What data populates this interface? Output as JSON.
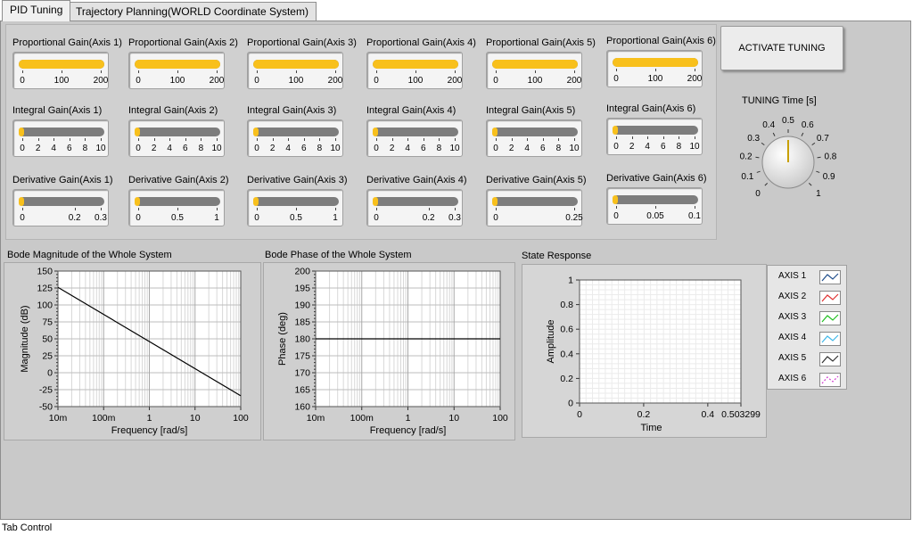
{
  "tabs": [
    {
      "label": "PID Tuning",
      "active": true
    },
    {
      "label": "Trajectory Planning(WORLD  Coordinate System)",
      "active": false
    }
  ],
  "footer_label": "Tab Control",
  "activate_button": "ACTIVATE TUNING",
  "tuning_time": {
    "label": "TUNING Time [s]",
    "scale": [
      "0",
      "0.1",
      "0.2",
      "0.3",
      "0.4",
      "0.5",
      "0.6",
      "0.7",
      "0.8",
      "0.9",
      "1"
    ],
    "value": 0.5
  },
  "gains": {
    "proportional": [
      {
        "label": "Proportional Gain(Axis 1)",
        "ticks": [
          "0",
          "100",
          "200"
        ],
        "fraction": 1.0
      },
      {
        "label": "Proportional Gain(Axis 2)",
        "ticks": [
          "0",
          "100",
          "200"
        ],
        "fraction": 1.0
      },
      {
        "label": "Proportional Gain(Axis 3)",
        "ticks": [
          "0",
          "100",
          "200"
        ],
        "fraction": 1.0
      },
      {
        "label": "Proportional Gain(Axis 4)",
        "ticks": [
          "0",
          "100",
          "200"
        ],
        "fraction": 1.0
      },
      {
        "label": "Proportional Gain(Axis 5)",
        "ticks": [
          "0",
          "100",
          "200"
        ],
        "fraction": 1.0
      },
      {
        "label": "Proportional Gain(Axis 6)",
        "ticks": [
          "0",
          "100",
          "200"
        ],
        "fraction": 1.0
      }
    ],
    "integral": [
      {
        "label": "Integral Gain(Axis 1)",
        "ticks": [
          "0",
          "2",
          "4",
          "6",
          "8",
          "10"
        ],
        "fraction": 0.0
      },
      {
        "label": "Integral Gain(Axis 2)",
        "ticks": [
          "0",
          "2",
          "4",
          "6",
          "8",
          "10"
        ],
        "fraction": 0.0
      },
      {
        "label": "Integral Gain(Axis 3)",
        "ticks": [
          "0",
          "2",
          "4",
          "6",
          "8",
          "10"
        ],
        "fraction": 0.0
      },
      {
        "label": "Integral Gain(Axis 4)",
        "ticks": [
          "0",
          "2",
          "4",
          "6",
          "8",
          "10"
        ],
        "fraction": 0.0
      },
      {
        "label": "Integral Gain(Axis 5)",
        "ticks": [
          "0",
          "2",
          "4",
          "6",
          "8",
          "10"
        ],
        "fraction": 0.0
      },
      {
        "label": "Integral Gain(Axis 6)",
        "ticks": [
          "0",
          "2",
          "4",
          "6",
          "8",
          "10"
        ],
        "fraction": 0.0
      }
    ],
    "derivative": [
      {
        "label": "Derivative Gain(Axis 1)",
        "ticks": [
          "0",
          "0.2",
          "0.3"
        ],
        "tickvals": [
          0,
          0.2,
          0.3
        ],
        "max": 0.3,
        "fraction": 0.0
      },
      {
        "label": "Derivative Gain(Axis 2)",
        "ticks": [
          "0",
          "0.5",
          "1"
        ],
        "tickvals": [
          0,
          0.5,
          1
        ],
        "max": 1,
        "fraction": 0.0
      },
      {
        "label": "Derivative Gain(Axis 3)",
        "ticks": [
          "0",
          "0.5",
          "1"
        ],
        "tickvals": [
          0,
          0.5,
          1
        ],
        "max": 1,
        "fraction": 0.0
      },
      {
        "label": "Derivative Gain(Axis 4)",
        "ticks": [
          "0",
          "0.2",
          "0.3"
        ],
        "tickvals": [
          0,
          0.2,
          0.3
        ],
        "max": 0.3,
        "fraction": 0.0
      },
      {
        "label": "Derivative Gain(Axis 5)",
        "ticks": [
          "0",
          "0.25"
        ],
        "tickvals": [
          0,
          0.25
        ],
        "max": 0.25,
        "fraction": 0.0
      },
      {
        "label": "Derivative Gain(Axis 6)",
        "ticks": [
          "0",
          "0.05",
          "0.1"
        ],
        "tickvals": [
          0,
          0.05,
          0.1
        ],
        "max": 0.1,
        "fraction": 0.0
      }
    ]
  },
  "plots": {
    "bode_mag": {
      "title": "Bode Magnitude of the Whole System",
      "xlabel": "Frequency [rad/s]",
      "ylabel": "Magnitude (dB)",
      "xticks": [
        "10m",
        "100m",
        "1",
        "10",
        "100"
      ],
      "yticks": [
        "150",
        "125",
        "100",
        "75",
        "50",
        "25",
        "0",
        "-25",
        "-50"
      ],
      "xlim": [
        0.01,
        100
      ],
      "ylim": [
        -50,
        150
      ],
      "line": {
        "x": [
          0.01,
          100
        ],
        "y": [
          126,
          -34
        ]
      }
    },
    "bode_phase": {
      "title": "Bode Phase of the Whole System",
      "xlabel": "Frequency [rad/s]",
      "ylabel": "Phase (deg)",
      "xticks": [
        "10m",
        "100m",
        "1",
        "10",
        "100"
      ],
      "yticks": [
        "200",
        "195",
        "190",
        "185",
        "180",
        "175",
        "170",
        "165",
        "160"
      ],
      "xlim": [
        0.01,
        100
      ],
      "ylim": [
        160,
        200
      ],
      "line": {
        "x": [
          0.01,
          100
        ],
        "y": [
          180,
          180
        ]
      }
    },
    "state": {
      "title": "State Response",
      "xlabel": "Time",
      "ylabel": "Amplitude",
      "xticks": [
        "0",
        "0.2",
        "0.4",
        "0.503299"
      ],
      "yticks": [
        "1",
        "0.8",
        "0.6",
        "0.4",
        "0.2",
        "0"
      ],
      "xlim": [
        0,
        0.503299
      ],
      "ylim": [
        0,
        1
      ]
    }
  },
  "legend": [
    {
      "name": "AXIS 1",
      "color": "#1f4e8c"
    },
    {
      "name": "AXIS 2",
      "color": "#e03030"
    },
    {
      "name": "AXIS 3",
      "color": "#20c020"
    },
    {
      "name": "AXIS 4",
      "color": "#40b8e8"
    },
    {
      "name": "AXIS 5",
      "color": "#303030"
    },
    {
      "name": "AXIS 6",
      "color": "#d040d0"
    }
  ],
  "chart_data": [
    {
      "type": "line",
      "title": "Bode Magnitude of the Whole System",
      "xlabel": "Frequency [rad/s]",
      "ylabel": "Magnitude (dB)",
      "xscale": "log",
      "xlim": [
        0.01,
        100
      ],
      "ylim": [
        -50,
        150
      ],
      "grid": true,
      "series": [
        {
          "x": [
            0.01,
            100
          ],
          "y": [
            126,
            -34
          ]
        }
      ]
    },
    {
      "type": "line",
      "title": "Bode Phase of the Whole System",
      "xlabel": "Frequency [rad/s]",
      "ylabel": "Phase (deg)",
      "xscale": "log",
      "xlim": [
        0.01,
        100
      ],
      "ylim": [
        160,
        200
      ],
      "grid": true,
      "series": [
        {
          "x": [
            0.01,
            100
          ],
          "y": [
            180,
            180
          ]
        }
      ]
    },
    {
      "type": "line",
      "title": "State Response",
      "xlabel": "Time",
      "ylabel": "Amplitude",
      "xlim": [
        0,
        0.503299
      ],
      "ylim": [
        0,
        1
      ],
      "grid": true,
      "legend": "right",
      "series": [
        {
          "name": "AXIS 1",
          "x": [],
          "y": []
        },
        {
          "name": "AXIS 2",
          "x": [],
          "y": []
        },
        {
          "name": "AXIS 3",
          "x": [],
          "y": []
        },
        {
          "name": "AXIS 4",
          "x": [],
          "y": []
        },
        {
          "name": "AXIS 5",
          "x": [],
          "y": []
        },
        {
          "name": "AXIS 6",
          "x": [],
          "y": []
        }
      ]
    }
  ]
}
